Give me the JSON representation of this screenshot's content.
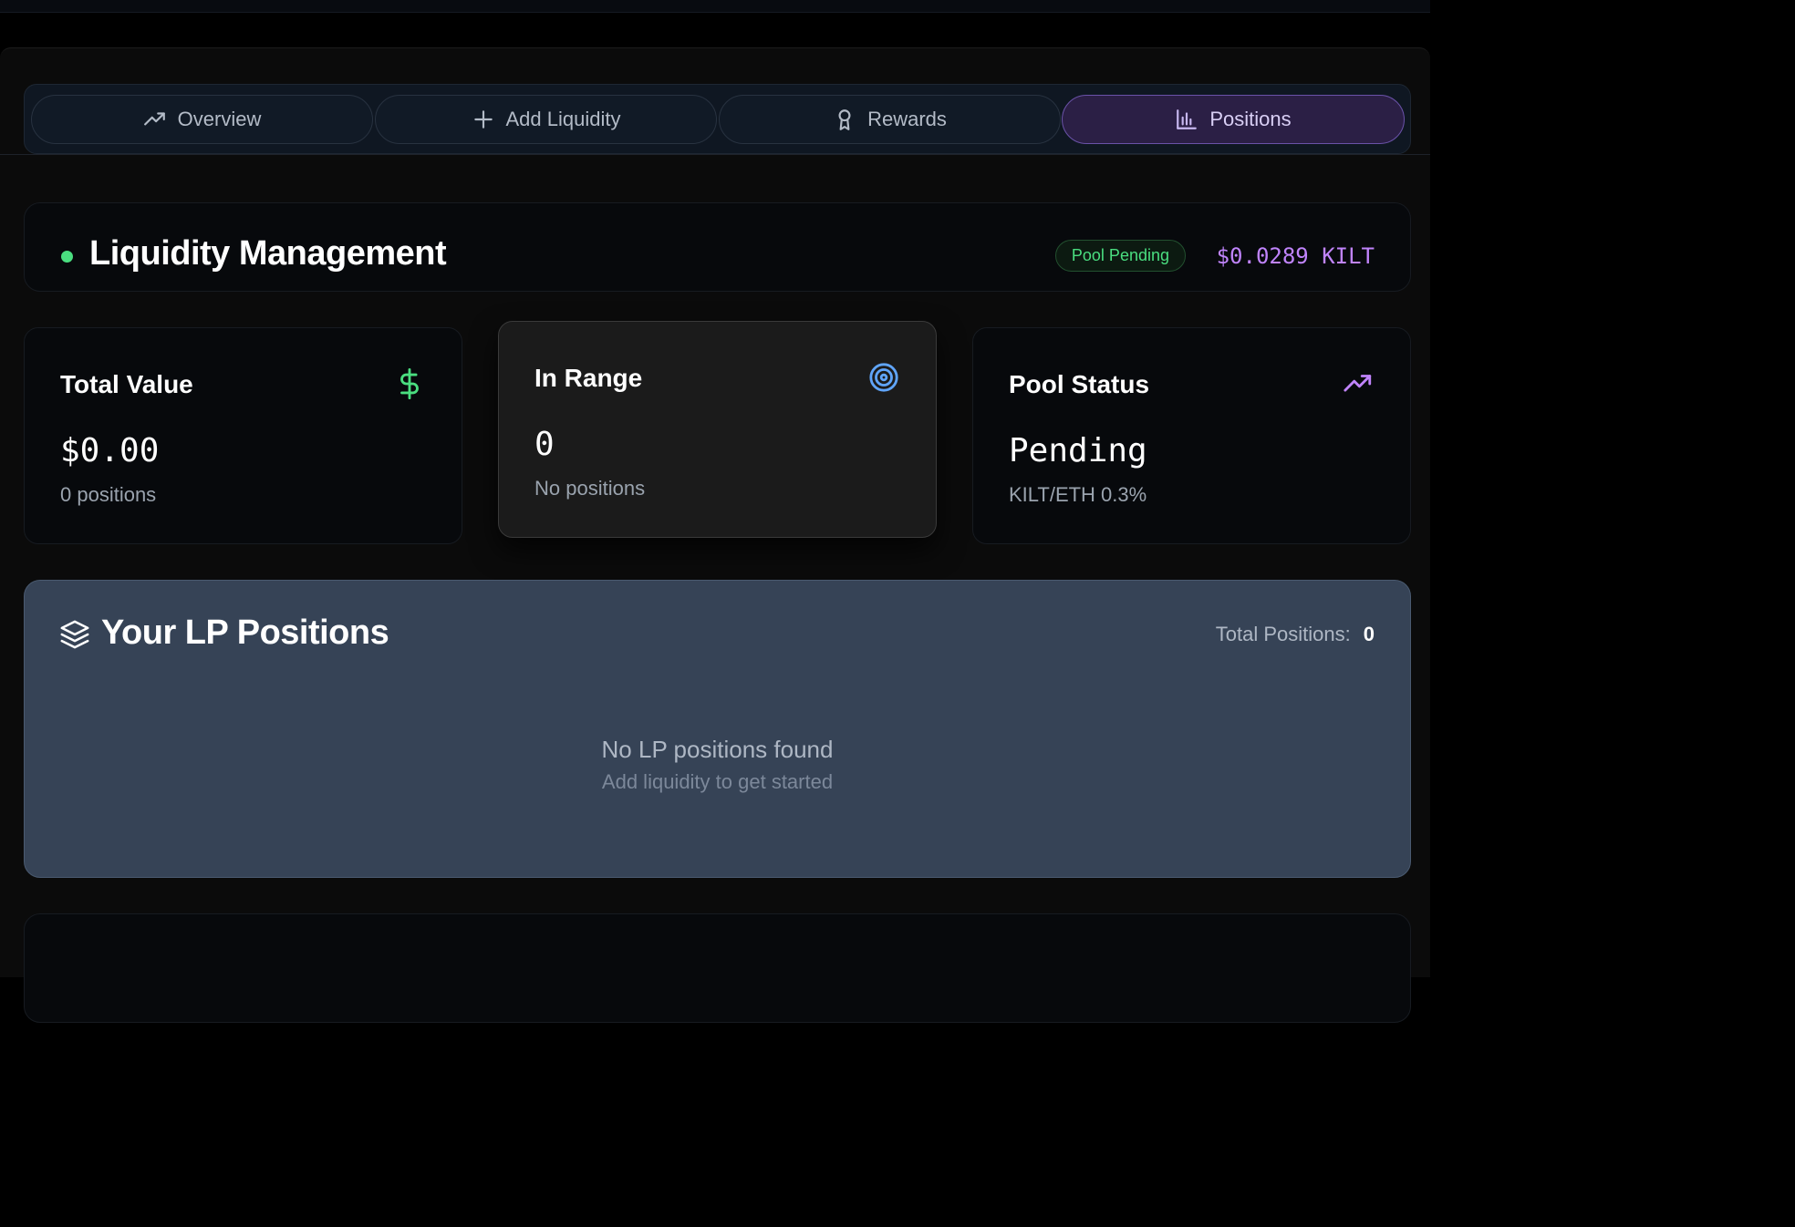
{
  "tabs": [
    {
      "label": "Overview",
      "icon": "trending-up-icon",
      "active": false
    },
    {
      "label": "Add Liquidity",
      "icon": "plus-icon",
      "active": false
    },
    {
      "label": "Rewards",
      "icon": "award-icon",
      "active": false
    },
    {
      "label": "Positions",
      "icon": "bar-chart-icon",
      "active": true
    }
  ],
  "header": {
    "title": "Liquidity Management",
    "badge": "Pool Pending",
    "price": "$0.0289 KILT"
  },
  "stats": [
    {
      "title": "Total Value",
      "value": "$0.00",
      "sub": "0 positions",
      "icon": "dollar-icon"
    },
    {
      "title": "In Range",
      "value": "0",
      "sub": "No positions",
      "icon": "target-icon"
    },
    {
      "title": "Pool Status",
      "value": "Pending",
      "sub": "KILT/ETH 0.3%",
      "icon": "trending-up-icon"
    }
  ],
  "lp_positions": {
    "title": "Your LP Positions",
    "total_label": "Total Positions:",
    "total_count": "0",
    "empty_title": "No LP positions found",
    "empty_subtitle": "Add liquidity to get started"
  },
  "colors": {
    "accent_purple": "#c084fc",
    "status_green": "#4ade80",
    "target_blue": "#60a5fa",
    "panel_slate": "#364356"
  }
}
